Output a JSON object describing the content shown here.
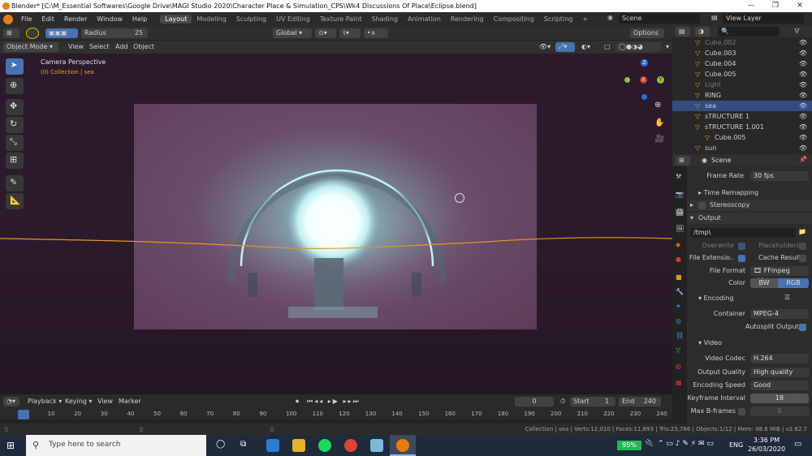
{
  "window": {
    "title": "Blender* [C:\\M_Essential Softwares\\Google Drive\\MAGI Studio 2020\\Character Place & Simulation_CPS\\Wk4 Discussions Of Place\\Eclipse.blend]"
  },
  "menu": [
    "File",
    "Edit",
    "Render",
    "Window",
    "Help"
  ],
  "workspaces": [
    "Layout",
    "Modeling",
    "Sculpting",
    "UV Editing",
    "Texture Paint",
    "Shading",
    "Animation",
    "Rendering",
    "Compositing",
    "Scripting"
  ],
  "scene_label": "Scene",
  "view_layer_label": "View Layer",
  "toolbar": {
    "radius_label": "Radius",
    "radius_value": "25",
    "orientation": "Global",
    "options": "Options"
  },
  "header": {
    "mode": "Object Mode",
    "view": "View",
    "select": "Select",
    "add": "Add",
    "object": "Object"
  },
  "viewport": {
    "camera_label": "Camera Perspective",
    "collection_label": "(0) Collection | sea"
  },
  "outliner": [
    {
      "name": "Cube.002",
      "muted": true
    },
    {
      "name": "Cube.003"
    },
    {
      "name": "Cube.004"
    },
    {
      "name": "Cube.005"
    },
    {
      "name": "Light",
      "muted": true
    },
    {
      "name": "RING"
    },
    {
      "name": "sea",
      "selected": true
    },
    {
      "name": "sTRUCTURE 1"
    },
    {
      "name": "sTRUCTURE 1.001"
    },
    {
      "name": "Cube.005",
      "child": true
    },
    {
      "name": "sun"
    }
  ],
  "properties": {
    "scene": "Scene",
    "frame_rate_label": "Frame Rate",
    "frame_rate": "30 fps",
    "time_remapping": "Time Remapping",
    "stereoscopy": "Stereoscopy",
    "output": "Output",
    "path": "/tmp\\",
    "overwrite": "Overwrite",
    "placeholders": "Placeholders",
    "file_ext": "File Extensio..",
    "cache_result": "Cache Result",
    "file_format_label": "File Format",
    "file_format": "FFmpeg vid...",
    "color_label": "Color",
    "bw": "BW",
    "rgb": "RGB",
    "encoding": "Encoding",
    "container_label": "Container",
    "container": "MPEG-4",
    "autosplit": "Autosplit Output",
    "video": "Video",
    "video_codec_label": "Video Codec",
    "video_codec": "H.264",
    "output_quality_label": "Output Quality",
    "output_quality": "High quality",
    "encoding_speed_label": "Encoding Speed",
    "encoding_speed": "Good",
    "keyframe_interval_label": "Keyframe Interval",
    "keyframe_interval": "18",
    "max_bframes_label": "Max B-frames",
    "max_bframes": "0"
  },
  "timeline": {
    "playback": "Playback",
    "keying": "Keying",
    "view": "View",
    "marker": "Marker",
    "current": "0",
    "start_label": "Start",
    "start": "1",
    "end_label": "End",
    "end": "240",
    "ticks": [
      "0",
      "10",
      "20",
      "30",
      "40",
      "50",
      "60",
      "70",
      "80",
      "90",
      "100",
      "110",
      "120",
      "130",
      "140",
      "150",
      "160",
      "170",
      "180",
      "190",
      "200",
      "210",
      "220",
      "230",
      "240"
    ]
  },
  "status": "Collection | sea | Verts:12,010 | Faces:11,893 | Tris:23,786 | Objects:1/12 | Mem: 48.6 MiB | v2.82.7",
  "taskbar": {
    "search_placeholder": "Type here to search",
    "battery": "95%",
    "lang": "ENG",
    "time": "3:36 PM",
    "date": "26/03/2020"
  }
}
